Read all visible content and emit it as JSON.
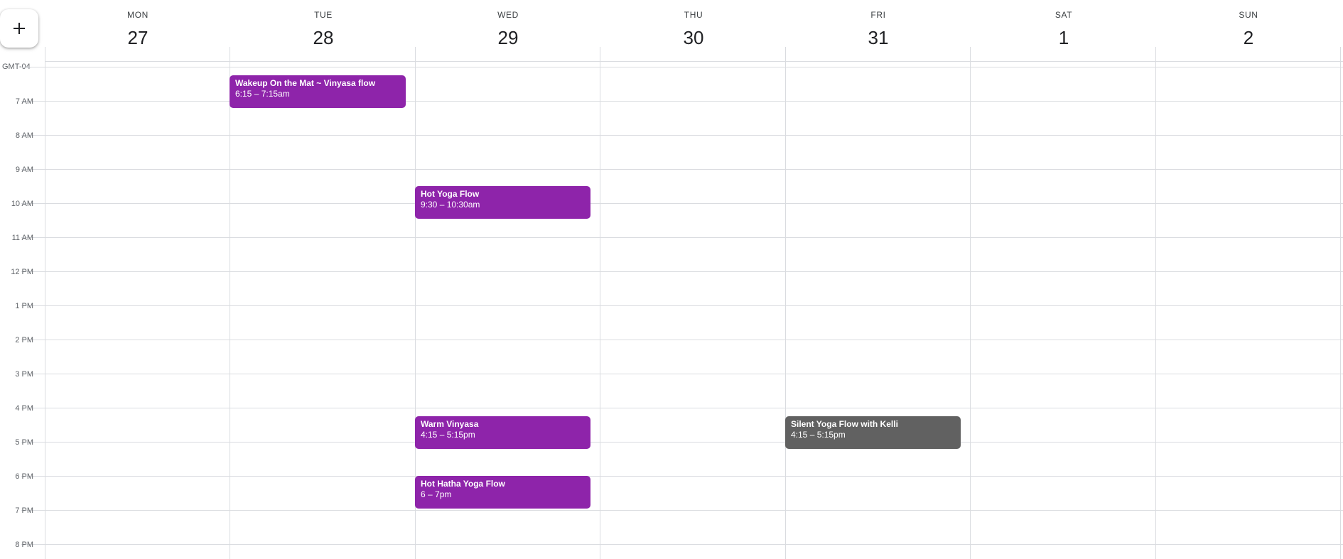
{
  "create_button": {
    "icon": "plus-icon"
  },
  "timezone": "GMT-04",
  "days": [
    {
      "dow": "MON",
      "num": "27"
    },
    {
      "dow": "TUE",
      "num": "28"
    },
    {
      "dow": "WED",
      "num": "29"
    },
    {
      "dow": "THU",
      "num": "30"
    },
    {
      "dow": "FRI",
      "num": "31"
    },
    {
      "dow": "SAT",
      "num": "1"
    },
    {
      "dow": "SUN",
      "num": "2"
    }
  ],
  "hours": [
    "7 AM",
    "8 AM",
    "9 AM",
    "10 AM",
    "11 AM",
    "12 PM",
    "1 PM",
    "2 PM",
    "3 PM",
    "4 PM",
    "5 PM",
    "6 PM",
    "7 PM",
    "8 PM"
  ],
  "events": [
    {
      "title": "Wakeup On the Mat ~ Vinyasa flow",
      "time": "6:15 – 7:15am",
      "color": "#8e24aa"
    },
    {
      "title": "Hot Yoga Flow",
      "time": "9:30 – 10:30am",
      "color": "#8e24aa"
    },
    {
      "title": "Warm Vinyasa",
      "time": "4:15 – 5:15pm",
      "color": "#8e24aa"
    },
    {
      "title": "Hot Hatha Yoga Flow",
      "time": "6 – 7pm",
      "color": "#8e24aa"
    },
    {
      "title": "Silent Yoga Flow with Kelli",
      "time": "4:15 – 5:15pm",
      "color": "#616161"
    }
  ]
}
